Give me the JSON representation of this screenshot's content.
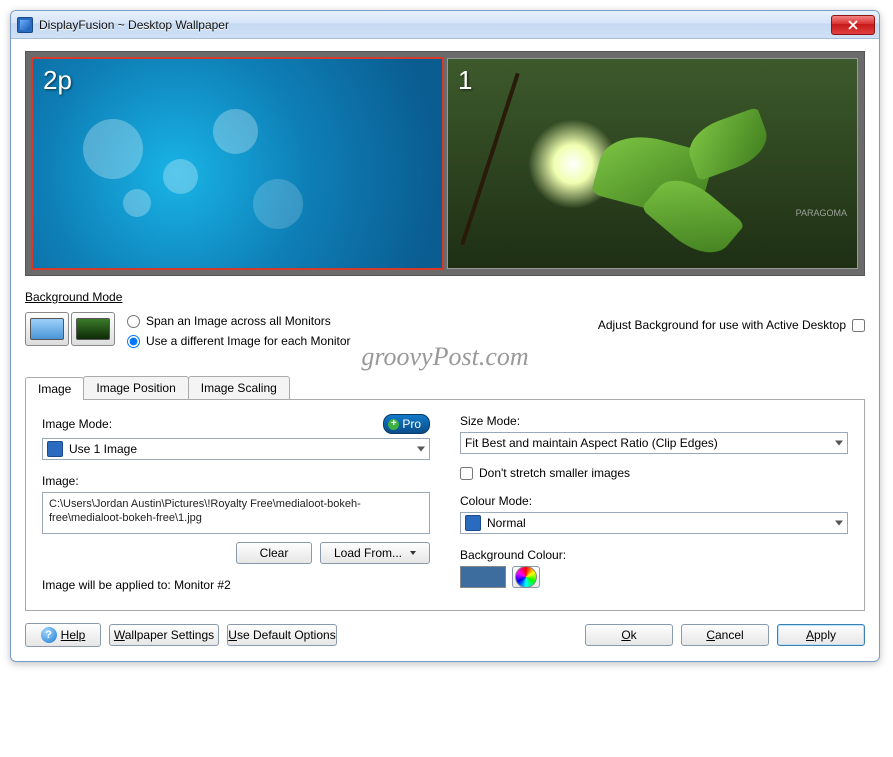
{
  "window": {
    "title": "DisplayFusion ~ Desktop Wallpaper"
  },
  "preview": {
    "monitor1_label": "2p",
    "monitor2_label": "1",
    "watermark": "PARAGOMA"
  },
  "background_mode": {
    "legend": "Background Mode",
    "option_span": "Span an Image across all Monitors",
    "option_diff": "Use a different Image for each Monitor",
    "selected": "diff",
    "adjust_label": "Adjust Background for use with Active Desktop",
    "adjust_checked": false
  },
  "overlay_watermark": "groovyPost.com",
  "tabs": {
    "image": "Image",
    "position": "Image Position",
    "scaling": "Image Scaling",
    "active": "image"
  },
  "image_tab": {
    "pro_label": "Pro",
    "image_mode_label": "Image Mode:",
    "image_mode_value": "Use 1 Image",
    "image_label": "Image:",
    "image_path": "C:\\Users\\Jordan Austin\\Pictures\\!Royalty Free\\medialoot-bokeh-free\\medialoot-bokeh-free\\1.jpg",
    "clear_btn": "Clear",
    "load_btn": "Load From...",
    "applied_text": "Image will be applied to: Monitor #2",
    "size_mode_label": "Size Mode:",
    "size_mode_value": "Fit Best and maintain Aspect Ratio (Clip Edges)",
    "dont_stretch_label": "Don't stretch smaller images",
    "dont_stretch_checked": false,
    "colour_mode_label": "Colour Mode:",
    "colour_mode_value": "Normal",
    "bg_colour_label": "Background Colour:",
    "bg_colour_hex": "#3d6c9e"
  },
  "footer": {
    "help": "Help",
    "wallpaper_settings": "Wallpaper Settings",
    "use_defaults": "Use Default Options",
    "ok": "Ok",
    "cancel": "Cancel",
    "apply": "Apply"
  }
}
